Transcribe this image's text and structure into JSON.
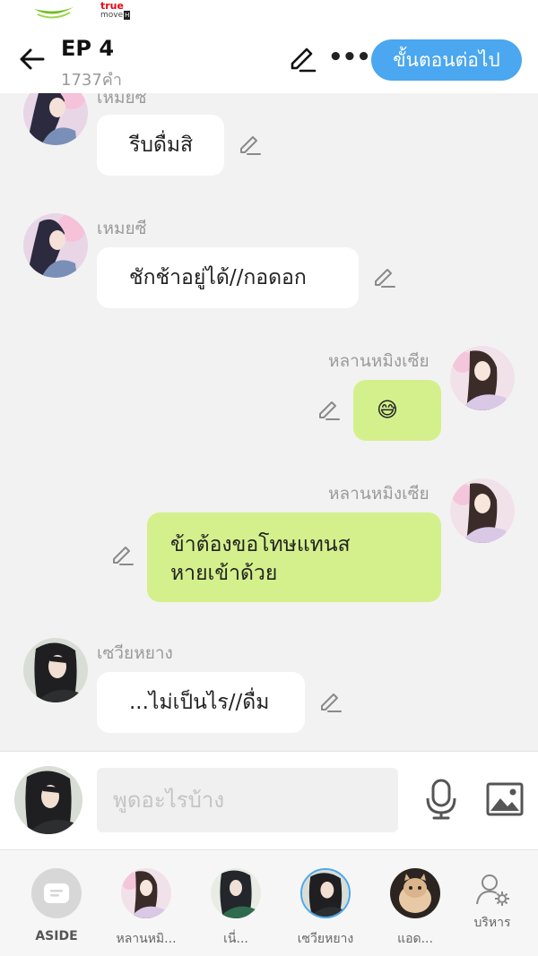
{
  "status": {
    "carrier_logo": "true move H",
    "carrier_name": "true",
    "carrier_sub": "move",
    "carrier_h": "H"
  },
  "header": {
    "title": "EP 4",
    "word_count": "1737คำ",
    "next_label": "ขั้นตอนต่อไป"
  },
  "messages": [
    {
      "sender": "เหมยซี",
      "text": "รีบดื่มสิ",
      "side": "left"
    },
    {
      "sender": "เหมยซี",
      "text": "ชักช้าอยู่ได้//กอดอก",
      "side": "left"
    },
    {
      "sender": "หลานหมิงเซีย",
      "text": "😅",
      "side": "right"
    },
    {
      "sender": "หลานหมิงเซีย",
      "text": "ข้าต้องขอโทษแทนส",
      "text2": "หายเข้าด้วย",
      "side": "right"
    },
    {
      "sender": "เซวียหยาง",
      "text": "...ไม่เป็นไร//ดื่ม",
      "side": "left"
    }
  ],
  "input": {
    "placeholder": "พูดอะไรบ้าง"
  },
  "bottom": {
    "aside_label": "ASIDE",
    "characters": [
      {
        "label": "หลานหมิ..."
      },
      {
        "label": "เนี่..."
      },
      {
        "label": "เซวียหยาง"
      },
      {
        "label": "แอด..."
      }
    ],
    "manage_label": "บริหาร"
  },
  "colors": {
    "accent": "#4ba7ef",
    "bubble_right": "#d4f08c",
    "bubble_left": "#ffffff",
    "background": "#f2f2f2"
  }
}
